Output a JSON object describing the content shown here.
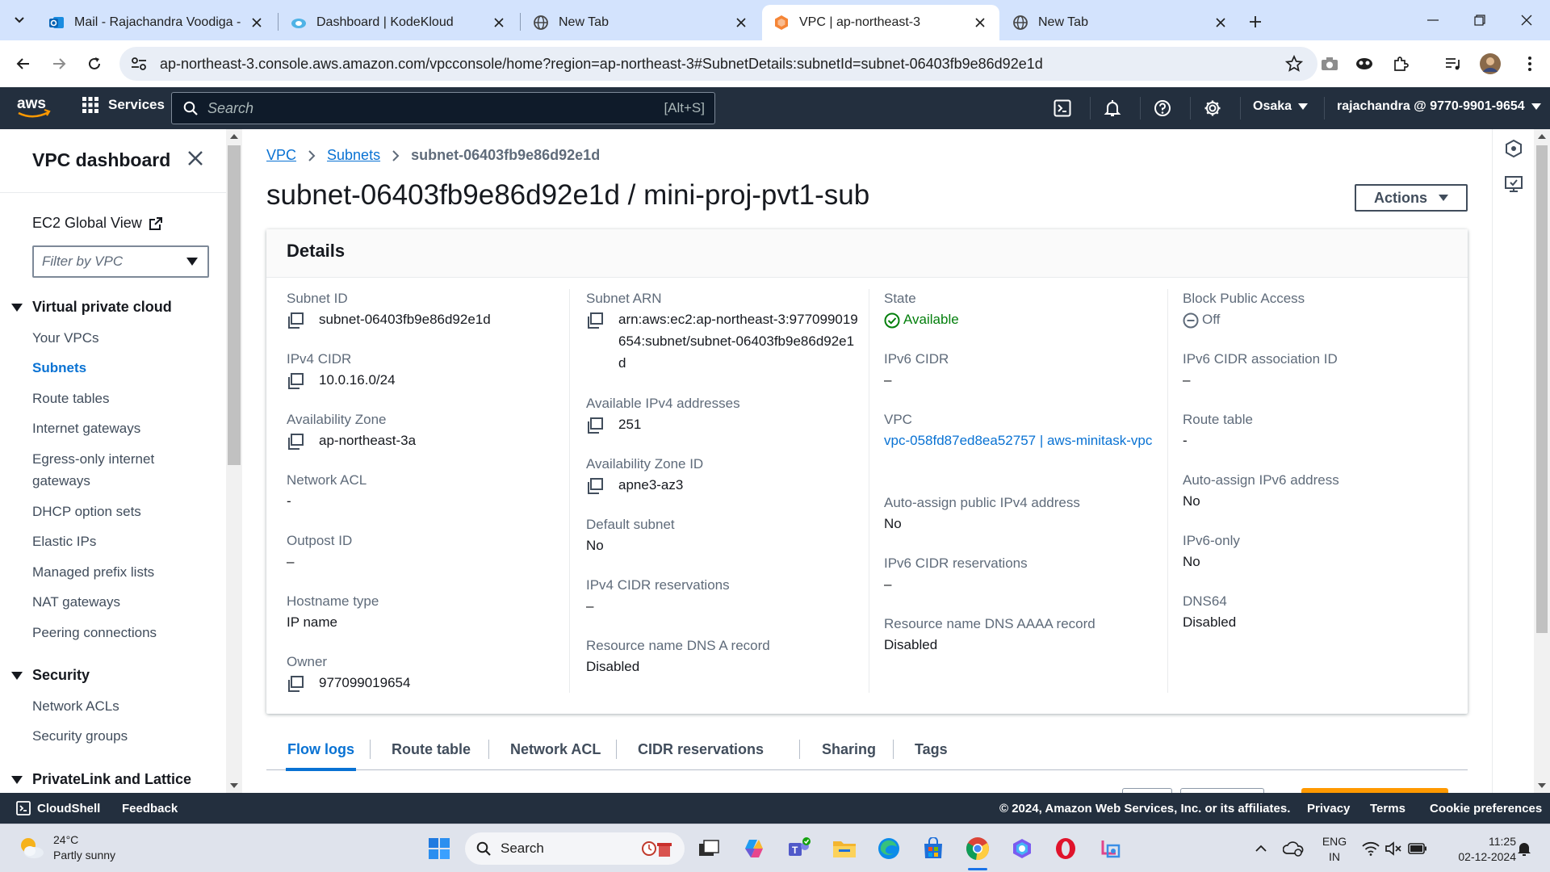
{
  "browser": {
    "tabs": [
      {
        "title": "Mail - Rajachandra Voodiga - O",
        "icon": "outlook-icon"
      },
      {
        "title": "Dashboard | KodeKloud",
        "icon": "kodekloud-icon"
      },
      {
        "title": "New Tab",
        "icon": "globe-icon"
      },
      {
        "title": "VPC | ap-northeast-3",
        "icon": "aws-vpc-icon"
      },
      {
        "title": "New Tab",
        "icon": "globe-icon"
      }
    ],
    "url": "ap-northeast-3.console.aws.amazon.com/vpcconsole/home?region=ap-northeast-3#SubnetDetails:subnetId=subnet-06403fb9e86d92e1d"
  },
  "aws_nav": {
    "logo": "aws",
    "services_label": "Services",
    "search_placeholder": "Search",
    "search_shortcut": "[Alt+S]",
    "region": "Osaka",
    "account": "rajachandra @ 9770-9901-9654"
  },
  "sidebar": {
    "title": "VPC dashboard",
    "global_view": "EC2 Global View",
    "filter_placeholder": "Filter by VPC",
    "sections": [
      {
        "label": "Virtual private cloud",
        "items": [
          "Your VPCs",
          "Subnets",
          "Route tables",
          "Internet gateways",
          "Egress-only internet gateways",
          "DHCP option sets",
          "Elastic IPs",
          "Managed prefix lists",
          "NAT gateways",
          "Peering connections"
        ]
      },
      {
        "label": "Security",
        "items": [
          "Network ACLs",
          "Security groups"
        ]
      },
      {
        "label": "PrivateLink and Lattice",
        "items": []
      }
    ],
    "active_item": "Subnets"
  },
  "breadcrumb": {
    "vpc": "VPC",
    "subnets": "Subnets",
    "current": "subnet-06403fb9e86d92e1d"
  },
  "page_title": "subnet-06403fb9e86d92e1d / mini-proj-pvt1-sub",
  "actions_label": "Actions",
  "details": {
    "heading": "Details",
    "col1": [
      {
        "label": "Subnet ID",
        "value": "subnet-06403fb9e86d92e1d",
        "copy": true
      },
      {
        "label": "IPv4 CIDR",
        "value": "10.0.16.0/24",
        "copy": true
      },
      {
        "label": "Availability Zone",
        "value": "ap-northeast-3a",
        "copy": true
      },
      {
        "label": "Network ACL",
        "value": "-"
      },
      {
        "label": "Outpost ID",
        "value": "–"
      },
      {
        "label": "Hostname type",
        "value": "IP name"
      },
      {
        "label": "Owner",
        "value": "977099019654",
        "copy": true
      }
    ],
    "col2": [
      {
        "label": "Subnet ARN",
        "value": "arn:aws:ec2:ap-northeast-3:977099019654:subnet/subnet-06403fb9e86d92e1d",
        "copy": true
      },
      {
        "label": "Available IPv4 addresses",
        "value": "251",
        "copy": true
      },
      {
        "label": "Availability Zone ID",
        "value": "apne3-az3",
        "copy": true
      },
      {
        "label": "Default subnet",
        "value": "No"
      },
      {
        "label": "IPv4 CIDR reservations",
        "value": "–"
      },
      {
        "label": "Resource name DNS A record",
        "value": "Disabled"
      }
    ],
    "col3": [
      {
        "label": "State",
        "value": "Available"
      },
      {
        "label": "IPv6 CIDR",
        "value": "–"
      },
      {
        "label": "VPC",
        "value": "vpc-058fd87ed8ea52757 | aws-minitask-vpc"
      },
      {
        "label": "Auto-assign public IPv4 address",
        "value": "No"
      },
      {
        "label": "IPv6 CIDR reservations",
        "value": "–"
      },
      {
        "label": "Resource name DNS AAAA record",
        "value": "Disabled"
      }
    ],
    "col4": [
      {
        "label": "Block Public Access",
        "value": "Off"
      },
      {
        "label": "IPv6 CIDR association ID",
        "value": "–"
      },
      {
        "label": "Route table",
        "value": "-"
      },
      {
        "label": "Auto-assign IPv6 address",
        "value": "No"
      },
      {
        "label": "IPv6-only",
        "value": "No"
      },
      {
        "label": "DNS64",
        "value": "Disabled"
      }
    ]
  },
  "detail_tabs": [
    "Flow logs",
    "Route table",
    "Network ACL",
    "CIDR reservations",
    "Sharing",
    "Tags"
  ],
  "footer": {
    "cloudshell": "CloudShell",
    "feedback": "Feedback",
    "copyright": "© 2024, Amazon Web Services, Inc. or its affiliates.",
    "links": [
      "Privacy",
      "Terms",
      "Cookie preferences"
    ]
  },
  "taskbar": {
    "temperature": "24°C",
    "weather": "Partly sunny",
    "search_label": "Search",
    "language_line1": "ENG",
    "language_line2": "IN",
    "time": "11:25",
    "date": "02-12-2024"
  },
  "colors": {
    "link": "#0972d3",
    "success": "#037f0c",
    "aws_nav": "#232f3e",
    "aws_orange": "#ff9900"
  }
}
